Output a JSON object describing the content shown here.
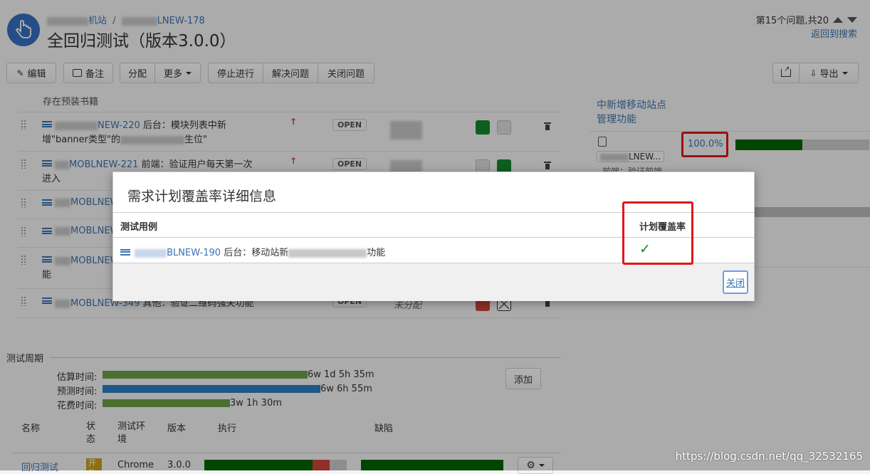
{
  "header": {
    "breadcrumb_project": "机站",
    "breadcrumb_sep": "/",
    "breadcrumb_issue": "LNEW-178",
    "title": "全回归测试（版本3.0.0）",
    "pager_text": "第15个问题,共20",
    "back_to_search": "返回到搜索"
  },
  "toolbar": {
    "edit": "编辑",
    "comment": "备注",
    "assign": "分配",
    "more": "更多",
    "stop_progress": "停止进行",
    "resolve": "解决问题",
    "close_issue": "关闭问题",
    "export": "导出"
  },
  "issues": {
    "top_partial": "存在预装书籍",
    "rows": [
      {
        "key": "NEW-220",
        "summary": "后台：模块列表中新",
        "summary2": "增\"banner类型\"的",
        "summary2b": "生位\"",
        "status": "OPEN"
      },
      {
        "key": "MOBLNEW-221",
        "summary": "前端：验证用户每天第一次",
        "summary2": "进入",
        "status": "OPEN"
      },
      {
        "key": "MOBLNEW",
        "summary": "",
        "summary2": "",
        "status": ""
      },
      {
        "key": "MOBLNEW",
        "summary": "",
        "summary2": "",
        "status": ""
      },
      {
        "key": "MOBLNEW",
        "summary": "",
        "summary2": "能",
        "status": ""
      },
      {
        "key": "MOBLNEW-349",
        "summary": "其他：验证二维码强关功能",
        "summary2": "",
        "status": "OPEN",
        "assignee": "未分配"
      }
    ]
  },
  "right_panel": {
    "link1": "中新增移动站点",
    "link2": "管理功能",
    "issue_key": "LNEW...",
    "issue_sub": "前端：验证前端",
    "coverage": "100.0%"
  },
  "test_cycle": {
    "title": "测试周期",
    "estimated_label": "估算时间:",
    "estimated_value": "6w 1d 5h 35m",
    "predicted_label": "预测时间:",
    "predicted_value": "6w 6h 55m",
    "spent_label": "花费时间:",
    "spent_value": "3w 1h 30m",
    "add_button": "添加",
    "columns": [
      "名称",
      "状态",
      "测试环境",
      "版本",
      "执行",
      "缺陷"
    ],
    "row": {
      "name": "回归测试",
      "status": "开放",
      "env": "Chrome",
      "version": "3.0.0"
    }
  },
  "dialog": {
    "title": "需求计划覆盖率详细信息",
    "col_testcase": "测试用例",
    "col_coverage": "计划覆盖率",
    "case_key": "BLNEW-190",
    "case_summary_a": "后台：移动站新",
    "case_summary_b": "功能",
    "coverage_mark": "✓",
    "close": "关闭"
  },
  "watermark": "https://blog.csdn.net/qq_32532165",
  "colors": {
    "link": "#3b73af",
    "highlight_red": "#e0161b",
    "bar_green": "#14892c",
    "bar_blue": "#2a7fc0",
    "bar_red": "#d04437",
    "bar_dark_green": "#006400"
  }
}
